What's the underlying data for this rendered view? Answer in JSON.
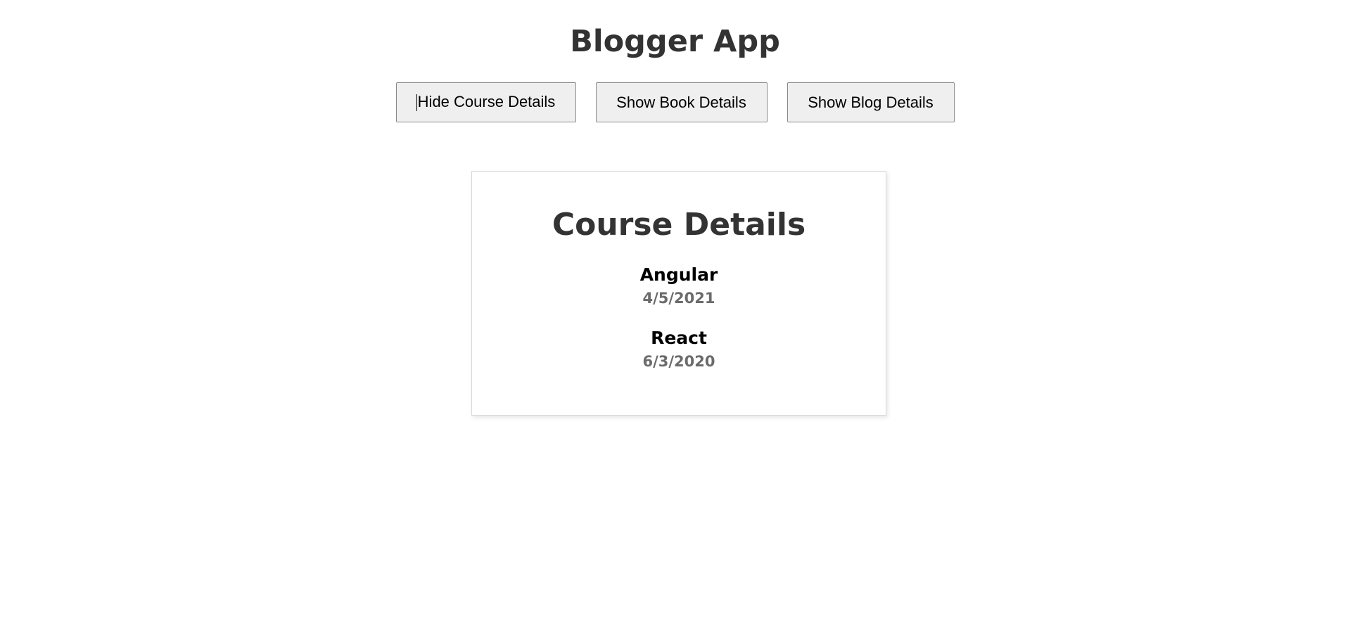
{
  "app": {
    "title": "Blogger App"
  },
  "toolbar": {
    "hide_course_label": "Hide Course Details",
    "show_book_label": "Show Book Details",
    "show_blog_label": "Show Blog Details"
  },
  "course_card": {
    "title": "Course Details",
    "items": [
      {
        "name": "Angular",
        "date": "4/5/2021"
      },
      {
        "name": "React",
        "date": "6/3/2020"
      }
    ]
  }
}
